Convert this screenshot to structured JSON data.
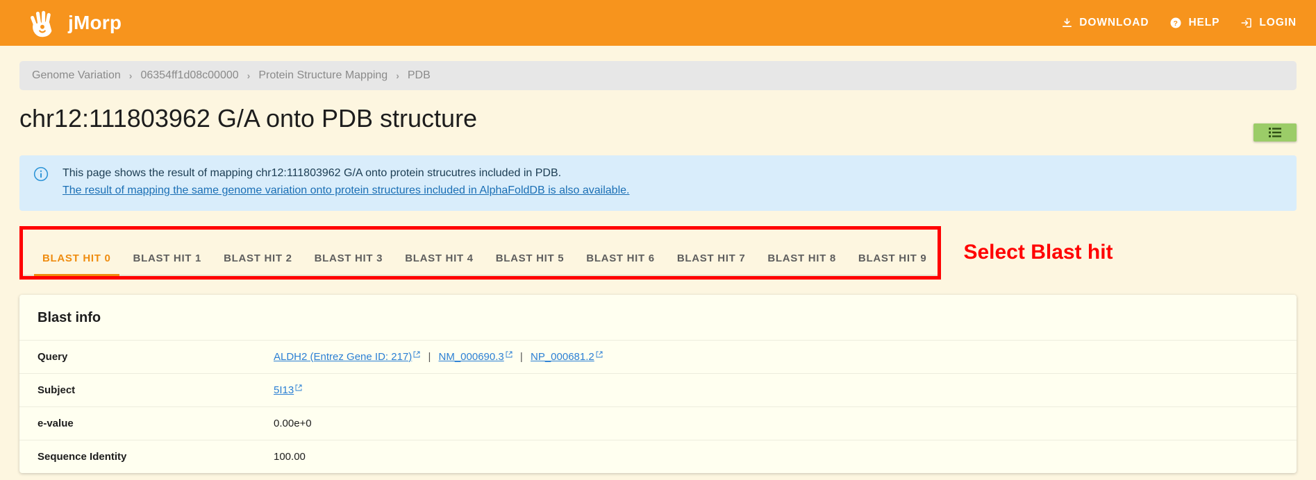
{
  "header": {
    "brand": "jMorp",
    "logo_icon": "hand-palm-logo",
    "nav": [
      {
        "label": "DOWNLOAD",
        "icon": "download-icon"
      },
      {
        "label": "HELP",
        "icon": "help-circle-icon"
      },
      {
        "label": "LOGIN",
        "icon": "login-arrow-icon"
      }
    ],
    "bg_color": "#f7941d"
  },
  "breadcrumb": {
    "items": [
      "Genome Variation",
      "06354ff1d08c00000",
      "Protein Structure Mapping",
      "PDB"
    ],
    "separator": "›"
  },
  "title": "chr12:111803962 G/A onto PDB structure",
  "list_button": {
    "icon": "list-menu-icon",
    "color": "#9bcc68"
  },
  "alert": {
    "icon": "info-circle-icon",
    "line1": "This page shows the result of mapping chr12:111803962 G/A onto protein strucutres included in PDB.",
    "link": "The result of mapping the same genome variation onto protein structures included in AlphaFoldDB is also available.",
    "bg_color": "#d9edfb",
    "link_color": "#1a6fb5"
  },
  "tabs": {
    "items": [
      {
        "label": "BLAST HIT 0",
        "active": true
      },
      {
        "label": "BLAST HIT 1",
        "active": false
      },
      {
        "label": "BLAST HIT 2",
        "active": false
      },
      {
        "label": "BLAST HIT 3",
        "active": false
      },
      {
        "label": "BLAST HIT 4",
        "active": false
      },
      {
        "label": "BLAST HIT 5",
        "active": false
      },
      {
        "label": "BLAST HIT 6",
        "active": false
      },
      {
        "label": "BLAST HIT 7",
        "active": false
      },
      {
        "label": "BLAST HIT 8",
        "active": false
      },
      {
        "label": "BLAST HIT 9",
        "active": false
      }
    ],
    "active_color": "#ef8c10"
  },
  "annotation": {
    "text": "Select Blast hit",
    "color": "#ff0000"
  },
  "blast_info": {
    "title": "Blast info",
    "rows": [
      {
        "label": "Query",
        "type": "links",
        "links": [
          {
            "text": "ALDH2 (Entrez Gene ID: 217)",
            "icon": "external-link-icon"
          },
          {
            "text": "NM_000690.3",
            "icon": "external-link-icon"
          },
          {
            "text": "NP_000681.2",
            "icon": "external-link-icon"
          }
        ],
        "separator": "|"
      },
      {
        "label": "Subject",
        "type": "links",
        "links": [
          {
            "text": "5I13",
            "icon": "external-link-icon"
          }
        ],
        "separator": "|"
      },
      {
        "label": "e-value",
        "type": "text",
        "value": "0.00e+0"
      },
      {
        "label": "Sequence Identity",
        "type": "text",
        "value": "100.00"
      }
    ]
  }
}
